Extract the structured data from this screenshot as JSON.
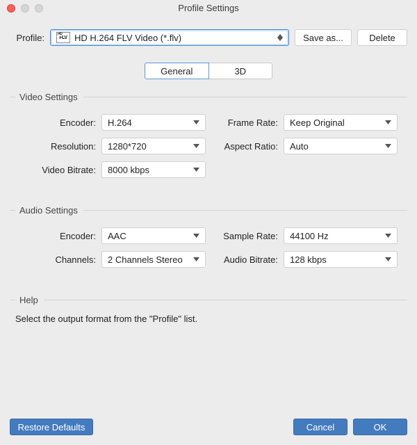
{
  "window": {
    "title": "Profile Settings"
  },
  "profile": {
    "label": "Profile:",
    "value": "HD H.264 FLV Video (*.flv)",
    "save_as_label": "Save as...",
    "delete_label": "Delete"
  },
  "tabs": {
    "general": "General",
    "threeD": "3D",
    "active": "general"
  },
  "video": {
    "group_label": "Video Settings",
    "encoder_label": "Encoder:",
    "encoder": "H.264",
    "resolution_label": "Resolution:",
    "resolution": "1280*720",
    "bitrate_label": "Video Bitrate:",
    "bitrate": "8000 kbps",
    "framerate_label": "Frame Rate:",
    "framerate": "Keep Original",
    "aspect_label": "Aspect Ratio:",
    "aspect": "Auto"
  },
  "audio": {
    "group_label": "Audio Settings",
    "encoder_label": "Encoder:",
    "encoder": "AAC",
    "channels_label": "Channels:",
    "channels": "2 Channels Stereo",
    "samplerate_label": "Sample Rate:",
    "samplerate": "44100 Hz",
    "bitrate_label": "Audio Bitrate:",
    "bitrate": "128 kbps"
  },
  "help": {
    "group_label": "Help",
    "text": "Select the output format from the \"Profile\" list."
  },
  "footer": {
    "restore_label": "Restore Defaults",
    "cancel_label": "Cancel",
    "ok_label": "OK"
  }
}
